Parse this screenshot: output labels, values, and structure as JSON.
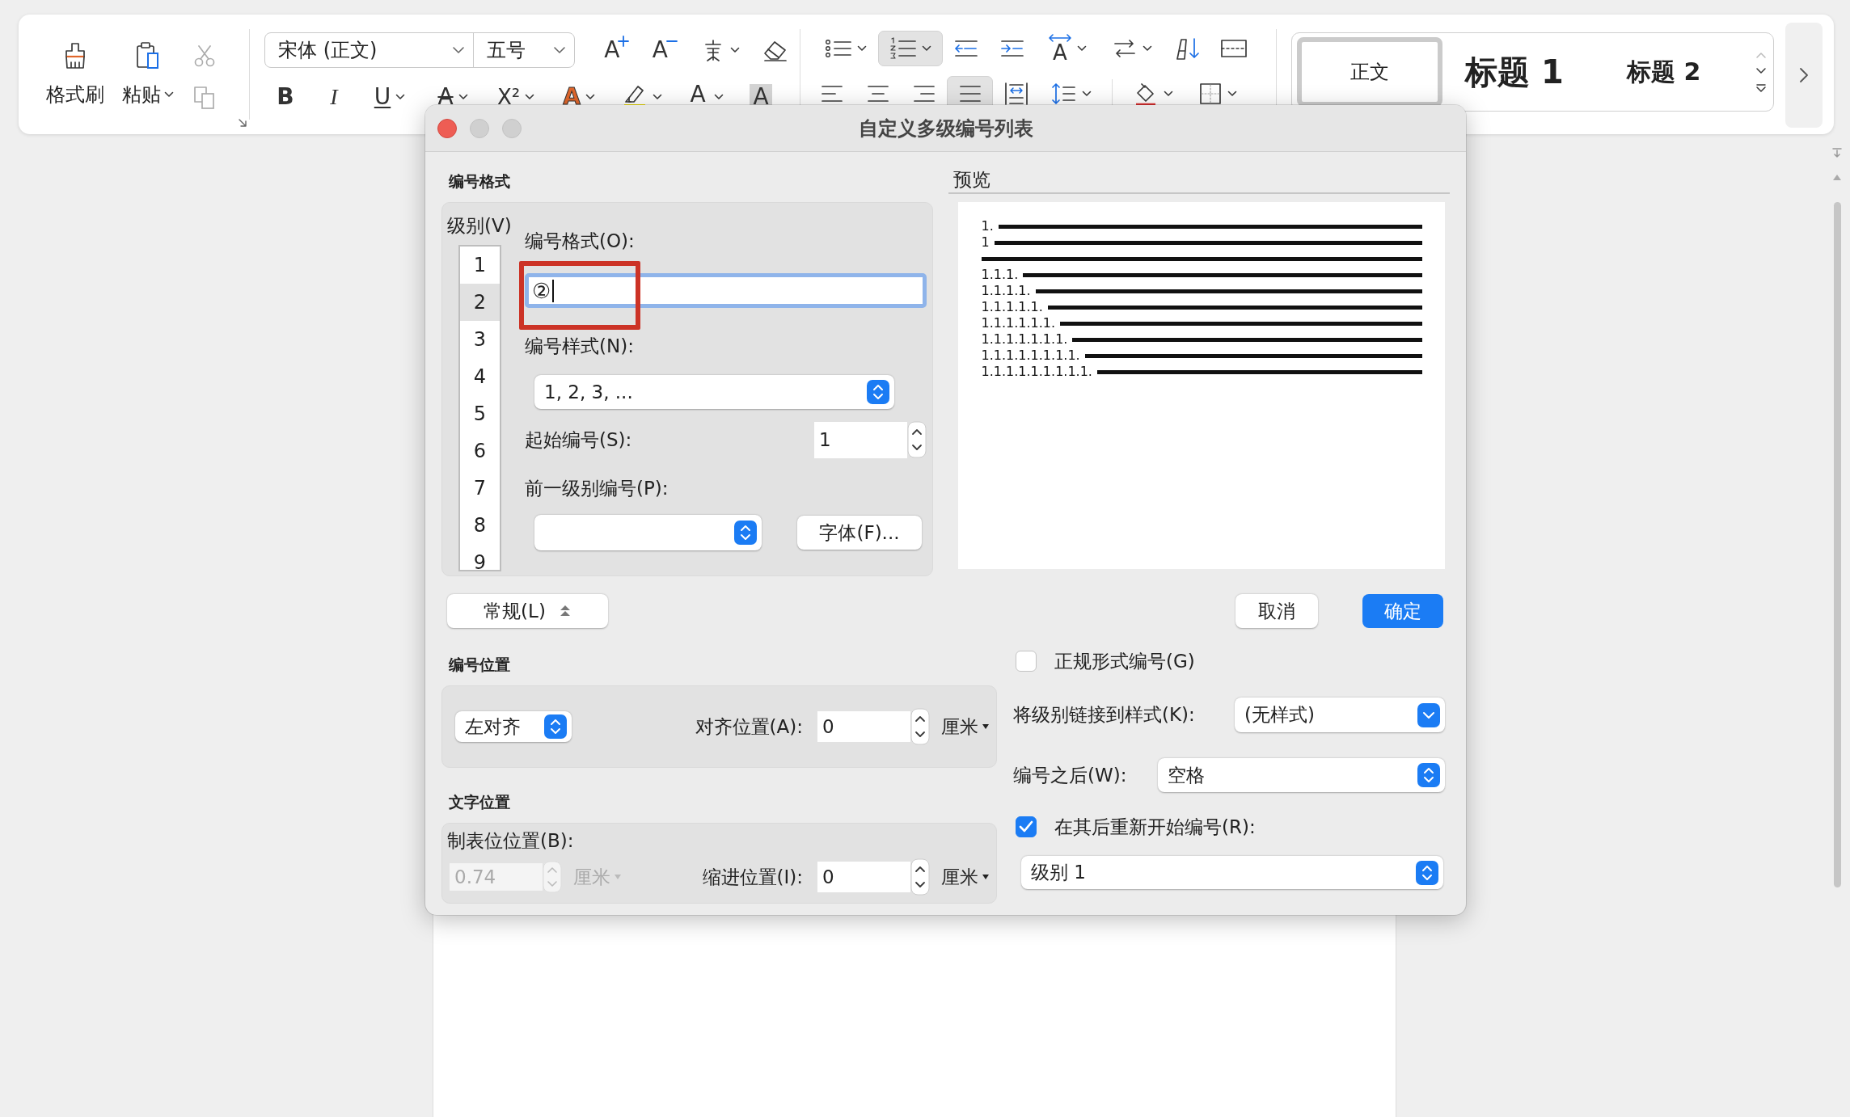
{
  "ribbon": {
    "clipboard": {
      "buttons": [
        {
          "kind": "brush",
          "label": "格式刷",
          "dropdown": false
        },
        {
          "kind": "paste",
          "label": "粘贴",
          "dropdown": true
        }
      ],
      "small": [
        {
          "kind": "cut",
          "disabled": true
        },
        {
          "kind": "copy",
          "disabled": true
        }
      ]
    },
    "font": {
      "name": "宋体 (正文)",
      "size": "五号",
      "row1": [
        {
          "kind": "grow",
          "glyph": "A",
          "dropdown": false
        },
        {
          "kind": "shrink",
          "glyph": "A",
          "dropdown": false
        },
        {
          "kind": "phonetic",
          "dropdown": true
        },
        {
          "kind": "eraser",
          "dropdown": false
        }
      ],
      "row2": [
        {
          "kind": "bold",
          "glyph": "B",
          "dropdown": false
        },
        {
          "kind": "italic",
          "glyph": "I",
          "dropdown": false
        },
        {
          "kind": "underline",
          "glyph": "U",
          "dropdown": true
        },
        {
          "kind": "strike",
          "glyph": "A",
          "dropdown": true
        },
        {
          "kind": "superscript",
          "glyph": "X²",
          "dropdown": true
        },
        {
          "kind": "effect",
          "glyph": "A",
          "dropdown": true
        },
        {
          "kind": "highlight",
          "dropdown": true
        },
        {
          "kind": "fontcolor",
          "glyph": "A",
          "dropdown": true
        },
        {
          "kind": "shaded",
          "glyph": "A",
          "dropdown": false
        }
      ]
    },
    "para": {
      "row1": [
        {
          "kind": "bullets",
          "dropdown": true,
          "selected": false
        },
        {
          "kind": "numbering",
          "dropdown": true,
          "selected": true
        },
        {
          "kind": "outdent",
          "dropdown": false,
          "selected": false
        },
        {
          "kind": "indent",
          "dropdown": false,
          "selected": false
        },
        {
          "kind": "textdir",
          "glyph": "A",
          "dropdown": true,
          "selected": false
        },
        {
          "kind": "swap",
          "dropdown": true,
          "selected": false
        },
        {
          "kind": "sort",
          "dropdown": false,
          "selected": false
        },
        {
          "kind": "columns",
          "dropdown": false,
          "selected": false
        }
      ],
      "row2": [
        {
          "kind": "left",
          "dropdown": false,
          "selected": false
        },
        {
          "kind": "center",
          "dropdown": false,
          "selected": false
        },
        {
          "kind": "right",
          "dropdown": false,
          "selected": false
        },
        {
          "kind": "justify",
          "dropdown": false,
          "selected": true
        },
        {
          "kind": "distribute",
          "dropdown": false,
          "selected": false
        },
        {
          "kind": "spacing",
          "dropdown": true,
          "selected": false
        }
      ],
      "row2b": [
        {
          "kind": "shading",
          "dropdown": true,
          "selected": false
        },
        {
          "kind": "borders",
          "dropdown": true,
          "selected": false
        }
      ]
    },
    "styles": [
      {
        "label": "正文",
        "kind": "normal",
        "selected": true
      },
      {
        "label": "标题 1",
        "kind": "heading1",
        "selected": false
      },
      {
        "label": "标题 2",
        "kind": "heading2",
        "selected": false
      }
    ]
  },
  "dialog": {
    "title": "自定义多级编号列表",
    "window_buttons": [
      {
        "kind": "close",
        "disabled": false
      },
      {
        "kind": "minimize",
        "disabled": true
      },
      {
        "kind": "zoom",
        "disabled": true
      }
    ],
    "format": {
      "heading": "编号格式",
      "level_label": "级别(V)",
      "levels": [
        {
          "label": "1",
          "selected": false
        },
        {
          "label": "2",
          "selected": true
        },
        {
          "label": "3",
          "selected": false
        },
        {
          "label": "4",
          "selected": false
        },
        {
          "label": "5",
          "selected": false
        },
        {
          "label": "6",
          "selected": false
        },
        {
          "label": "7",
          "selected": false
        },
        {
          "label": "8",
          "selected": false
        },
        {
          "label": "9",
          "selected": false
        }
      ],
      "format_label": "编号格式(O):",
      "format_value": "②",
      "format_highlight": {
        "color": "#cc3326"
      },
      "style_label": "编号样式(N):",
      "style_value": "1, 2, 3, ...",
      "start_label": "起始编号(S):",
      "start_value": "1",
      "prev_label": "前一级别编号(P):",
      "font_button": "字体(F)..."
    },
    "preview": {
      "heading": "预览",
      "lines": [
        {
          "kind": "numbered",
          "number": "1."
        },
        {
          "kind": "numbered",
          "number": "1"
        },
        {
          "kind": "rule"
        },
        {
          "kind": "numbered",
          "number": "1.1.1."
        },
        {
          "kind": "numbered",
          "number": "1.1.1.1."
        },
        {
          "kind": "numbered",
          "number": "1.1.1.1.1."
        },
        {
          "kind": "numbered",
          "number": "1.1.1.1.1.1."
        },
        {
          "kind": "numbered",
          "number": "1.1.1.1.1.1.1."
        },
        {
          "kind": "numbered",
          "number": "1.1.1.1.1.1.1.1."
        },
        {
          "kind": "numbered",
          "number": "1.1.1.1.1.1.1.1.1."
        }
      ]
    },
    "more_button": {
      "label": "常规(L)",
      "expanded": true
    },
    "cancel": "取消",
    "ok": "确定",
    "number_position": {
      "heading": "编号位置",
      "alignment": "左对齐",
      "align_label": "对齐位置(A):",
      "align_value": "0",
      "unit": "厘米"
    },
    "text_position": {
      "heading": "文字位置",
      "tab_label": "制表位位置(B):",
      "tab_value": "0.74",
      "tab_disabled": true,
      "tab_unit": "厘米",
      "indent_label": "缩进位置(I):",
      "indent_value": "0",
      "indent_unit": "厘米"
    },
    "legal": {
      "label": "正规形式编号(G)",
      "checked": false
    },
    "link": {
      "label": "将级别链接到样式(K):",
      "value": "(无样式)"
    },
    "follow": {
      "label": "编号之后(W):",
      "value": "空格"
    },
    "restart": {
      "label": "在其后重新开始编号(R):",
      "checked": true,
      "value": "级别 1"
    }
  }
}
